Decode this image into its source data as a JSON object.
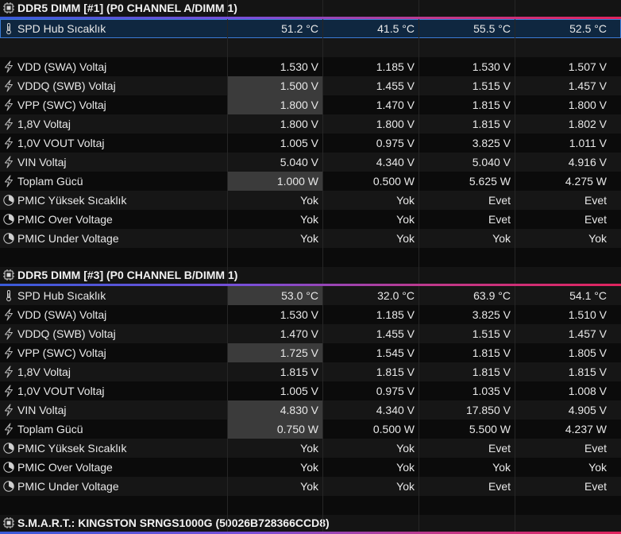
{
  "groups": [
    {
      "title": "DDR5 DIMM [#1] (P0 CHANNEL A/DIMM 1)",
      "rows": [
        {
          "icon": "thermometer",
          "name": "SPD Hub Sıcaklık",
          "values": [
            "51.2 °C",
            "41.5 °C",
            "55.5 °C",
            "52.5 °C"
          ],
          "selected": true
        },
        {
          "blank": true
        },
        {
          "icon": "lightning",
          "name": "VDD (SWA) Voltaj",
          "values": [
            "1.530 V",
            "1.185 V",
            "1.530 V",
            "1.507 V"
          ]
        },
        {
          "icon": "lightning",
          "name": "VDDQ (SWB) Voltaj",
          "values": [
            "1.500 V",
            "1.455 V",
            "1.515 V",
            "1.457 V"
          ],
          "highlight": true
        },
        {
          "icon": "lightning",
          "name": "VPP (SWC) Voltaj",
          "values": [
            "1.800 V",
            "1.470 V",
            "1.815 V",
            "1.800 V"
          ],
          "highlight": true
        },
        {
          "icon": "lightning",
          "name": "1,8V Voltaj",
          "values": [
            "1.800 V",
            "1.800 V",
            "1.815 V",
            "1.802 V"
          ]
        },
        {
          "icon": "lightning",
          "name": "1,0V VOUT Voltaj",
          "values": [
            "1.005 V",
            "0.975 V",
            "3.825 V",
            "1.011 V"
          ]
        },
        {
          "icon": "lightning",
          "name": "VIN Voltaj",
          "values": [
            "5.040 V",
            "4.340 V",
            "5.040 V",
            "4.916 V"
          ]
        },
        {
          "icon": "lightning",
          "name": "Toplam Gücü",
          "values": [
            "1.000 W",
            "0.500 W",
            "5.625 W",
            "4.275 W"
          ],
          "highlight": true
        },
        {
          "icon": "clock",
          "name": "PMIC Yüksek Sıcaklık",
          "values": [
            "Yok",
            "Yok",
            "Evet",
            "Evet"
          ]
        },
        {
          "icon": "clock",
          "name": "PMIC Over Voltage",
          "values": [
            "Yok",
            "Yok",
            "Evet",
            "Evet"
          ]
        },
        {
          "icon": "clock",
          "name": "PMIC Under Voltage",
          "values": [
            "Yok",
            "Yok",
            "Yok",
            "Yok"
          ]
        },
        {
          "blank": true
        }
      ]
    },
    {
      "title": "DDR5 DIMM [#3] (P0 CHANNEL B/DIMM 1)",
      "rows": [
        {
          "icon": "thermometer",
          "name": "SPD Hub Sıcaklık",
          "values": [
            "53.0 °C",
            "32.0 °C",
            "63.9 °C",
            "54.1 °C"
          ],
          "highlight": true
        },
        {
          "icon": "lightning",
          "name": "VDD (SWA) Voltaj",
          "values": [
            "1.530 V",
            "1.185 V",
            "3.825 V",
            "1.510 V"
          ]
        },
        {
          "icon": "lightning",
          "name": "VDDQ (SWB) Voltaj",
          "values": [
            "1.470 V",
            "1.455 V",
            "1.515 V",
            "1.457 V"
          ]
        },
        {
          "icon": "lightning",
          "name": "VPP (SWC) Voltaj",
          "values": [
            "1.725 V",
            "1.545 V",
            "1.815 V",
            "1.805 V"
          ],
          "highlight": true
        },
        {
          "icon": "lightning",
          "name": "1,8V Voltaj",
          "values": [
            "1.815 V",
            "1.815 V",
            "1.815 V",
            "1.815 V"
          ]
        },
        {
          "icon": "lightning",
          "name": "1,0V VOUT Voltaj",
          "values": [
            "1.005 V",
            "0.975 V",
            "1.035 V",
            "1.008 V"
          ]
        },
        {
          "icon": "lightning",
          "name": "VIN Voltaj",
          "values": [
            "4.830 V",
            "4.340 V",
            "17.850 V",
            "4.905 V"
          ],
          "highlight": true
        },
        {
          "icon": "lightning",
          "name": "Toplam Gücü",
          "values": [
            "0.750 W",
            "0.500 W",
            "5.500 W",
            "4.237 W"
          ],
          "highlight": true
        },
        {
          "icon": "clock",
          "name": "PMIC Yüksek Sıcaklık",
          "values": [
            "Yok",
            "Yok",
            "Evet",
            "Evet"
          ]
        },
        {
          "icon": "clock",
          "name": "PMIC Over Voltage",
          "values": [
            "Yok",
            "Yok",
            "Yok",
            "Yok"
          ]
        },
        {
          "icon": "clock",
          "name": "PMIC Under Voltage",
          "values": [
            "Yok",
            "Yok",
            "Evet",
            "Evet"
          ]
        },
        {
          "blank": true
        }
      ]
    },
    {
      "title": "S.M.A.R.T.: KINGSTON SRNGS1000G (50026B728366CCD8)",
      "rows": []
    }
  ],
  "colors": {
    "background": "#000000",
    "selected_row": "#0f2740",
    "selected_outline": "#3a7bd5",
    "highlight_cell": "#3b3b3b",
    "group_bar_start": "#3a5bd9",
    "group_bar_end": "#e0245e"
  }
}
